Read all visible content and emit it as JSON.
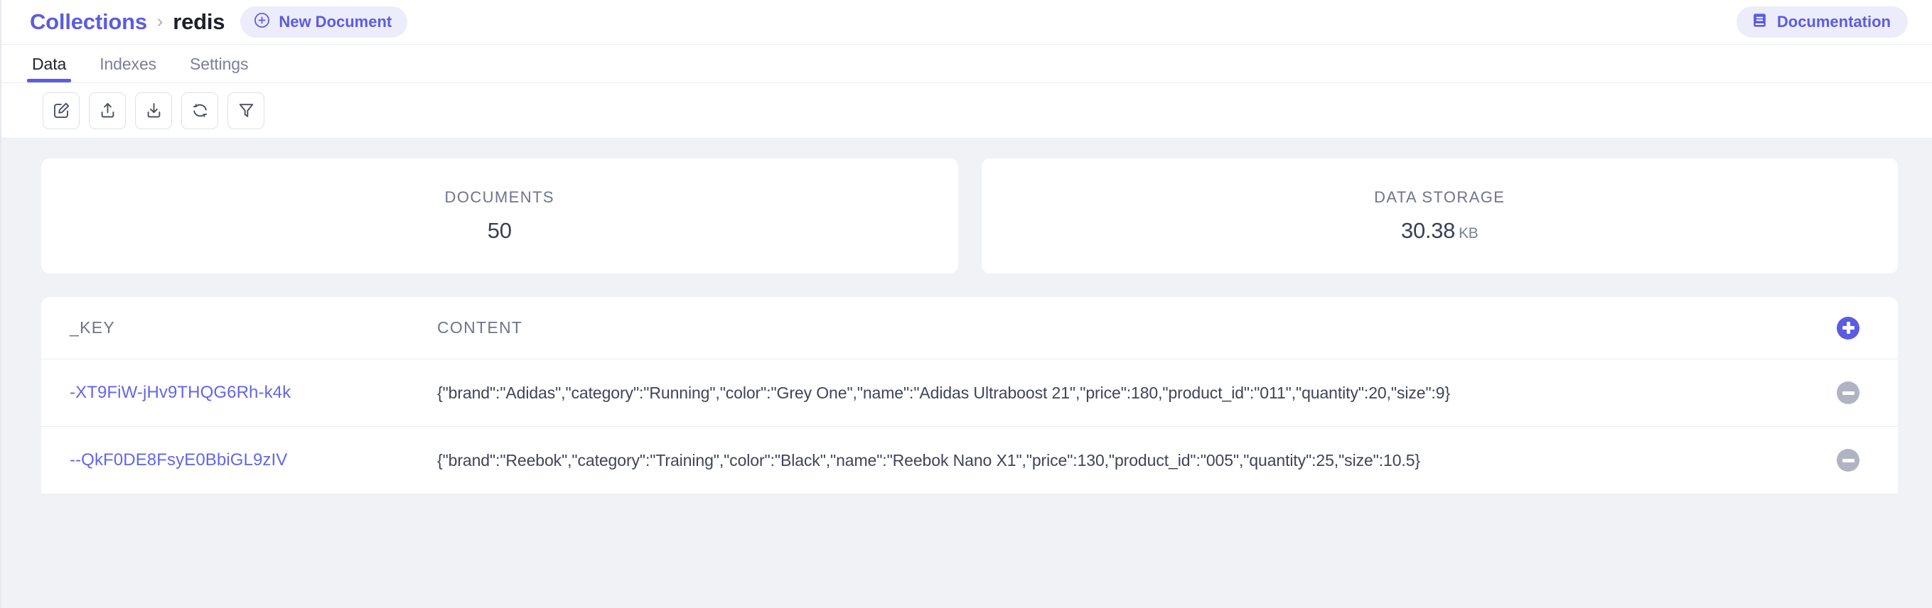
{
  "header": {
    "breadcrumb": {
      "root_label": "Collections",
      "separator": "›",
      "current_label": "redis"
    },
    "new_document_label": "New Document",
    "new_document_icon": "plus-circle-outline-icon",
    "documentation_label": "Documentation",
    "documentation_icon": "book-icon"
  },
  "tabs": [
    {
      "label": "Data",
      "active": true
    },
    {
      "label": "Indexes",
      "active": false
    },
    {
      "label": "Settings",
      "active": false
    }
  ],
  "toolbar": {
    "buttons": [
      {
        "name": "edit-button",
        "icon": "pencil-square-icon",
        "title": "Edit"
      },
      {
        "name": "export-button",
        "icon": "upload-icon",
        "title": "Export"
      },
      {
        "name": "import-button",
        "icon": "download-icon",
        "title": "Import"
      },
      {
        "name": "refresh-button",
        "icon": "refresh-icon",
        "title": "Refresh"
      },
      {
        "name": "filter-button",
        "icon": "funnel-icon",
        "title": "Filter"
      }
    ]
  },
  "stats": [
    {
      "label": "DOCUMENTS",
      "value": "50",
      "unit": ""
    },
    {
      "label": "DATA STORAGE",
      "value": "30.38",
      "unit": "KB"
    }
  ],
  "table": {
    "columns": [
      "_KEY",
      "CONTENT"
    ],
    "add_icon": "plus-circle-filled-icon",
    "remove_icon": "minus-circle-filled-icon",
    "rows": [
      {
        "key": "-XT9FiW-jHv9THQG6Rh-k4k",
        "content": "{\"brand\":\"Adidas\",\"category\":\"Running\",\"color\":\"Grey One\",\"name\":\"Adidas Ultraboost 21\",\"price\":180,\"product_id\":\"011\",\"quantity\":20,\"size\":9}"
      },
      {
        "key": "--QkF0DE8FsyE0BbiGL9zIV",
        "content": "{\"brand\":\"Reebok\",\"category\":\"Training\",\"color\":\"Black\",\"name\":\"Reebok Nano X1\",\"price\":130,\"product_id\":\"005\",\"quantity\":25,\"size\":10.5}"
      }
    ]
  },
  "colors": {
    "accent": "#5b5ce2",
    "accent_soft": "#ececfb",
    "page_bg": "#f1f2f5",
    "muted_text": "#6f748d",
    "remove_grey": "#b0b3c4"
  }
}
